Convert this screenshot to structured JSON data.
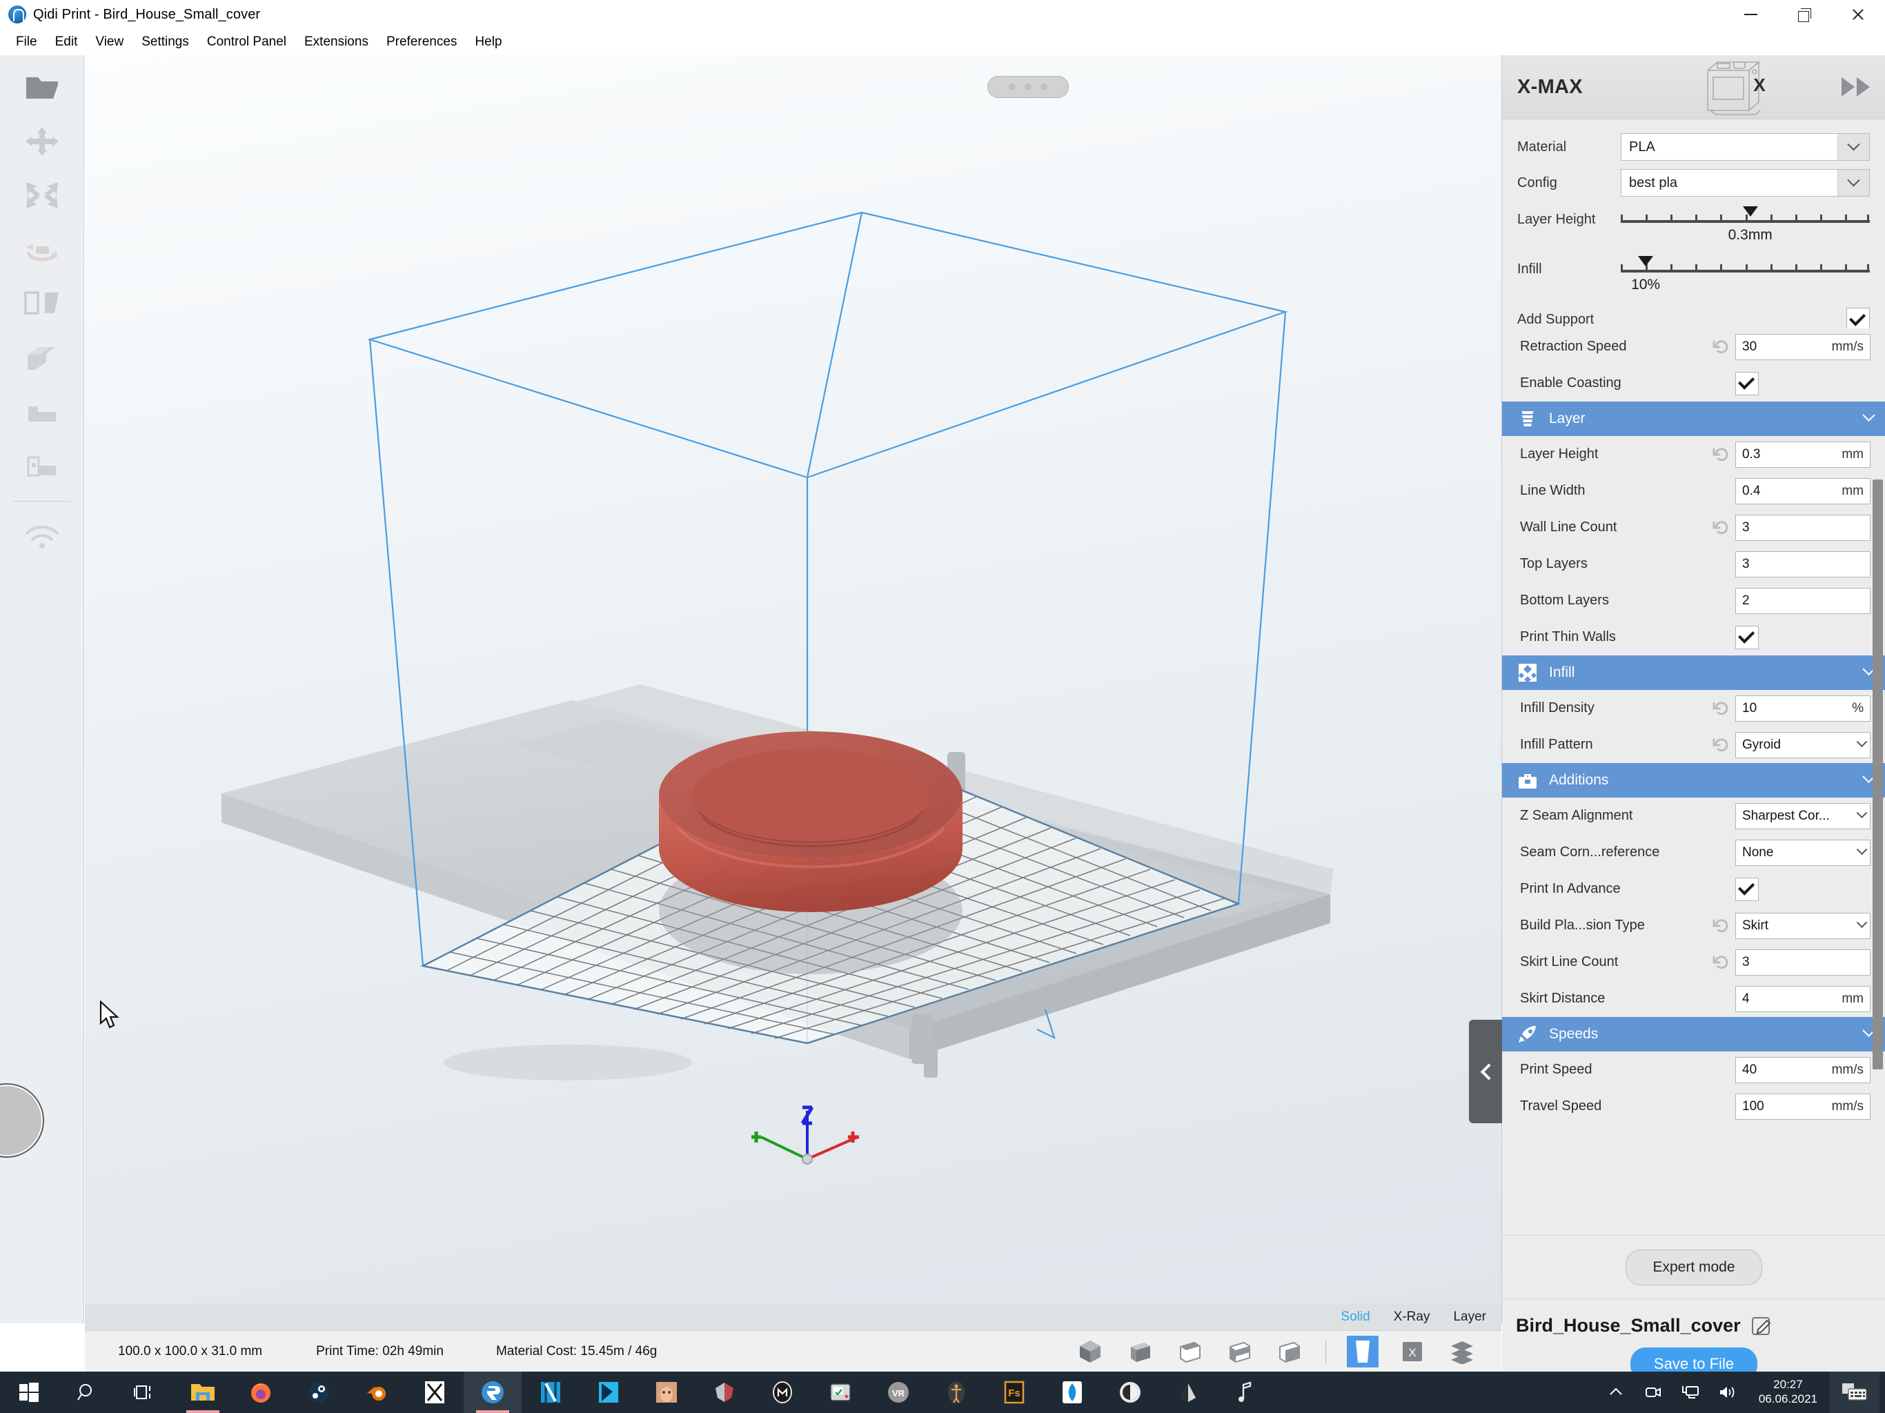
{
  "window": {
    "title": "Qidi Print - Bird_House_Small_cover",
    "app_icon": "qidi-logo-icon",
    "controls": {
      "minimize": "minimize-icon",
      "restore": "restore-icon",
      "close": "close-icon"
    }
  },
  "menubar": {
    "items": [
      "File",
      "Edit",
      "View",
      "Settings",
      "Control Panel",
      "Extensions",
      "Preferences",
      "Help"
    ]
  },
  "left_toolbar": {
    "items": [
      {
        "name": "open-file-icon",
        "tip": "Open File"
      },
      {
        "name": "move-icon",
        "tip": "Move"
      },
      {
        "name": "scale-icon",
        "tip": "Scale"
      },
      {
        "name": "rotate-icon",
        "tip": "Rotate"
      },
      {
        "name": "mirror-icon",
        "tip": "Mirror"
      },
      {
        "name": "support-blocker-icon",
        "tip": "Support Blocker"
      },
      {
        "name": "per-model-settings-icon",
        "tip": "Per Model Settings"
      },
      {
        "name": "multiply-model-icon",
        "tip": "Multiply Model"
      },
      {
        "name": "wifi-icon",
        "tip": "Wi-Fi Connection"
      }
    ]
  },
  "viewport": {
    "model_color": "#c2584c",
    "buildplate_outline_color": "#4a9de0",
    "axis_colors": {
      "x": "#d52b2b",
      "y": "#1aa01a",
      "z": "#2222dd"
    },
    "top_pill": "drag-handle"
  },
  "viewmodes": {
    "items": [
      {
        "label": "Solid",
        "active": true
      },
      {
        "label": "X-Ray",
        "active": false
      },
      {
        "label": "Layer",
        "active": false
      }
    ],
    "active_color": "#3ba0e8"
  },
  "statusbar": {
    "dimensions": "100.0 x 100.0 x 31.0 mm",
    "print_time": "Print Time: 02h 49min",
    "material_cost": "Material Cost: 15.45m / 46g",
    "view_icons": [
      "view-3d-icon",
      "view-front-icon",
      "view-top-icon",
      "view-left-icon",
      "view-right-icon"
    ],
    "mode_icons": [
      {
        "name": "solid-view-icon",
        "selected": true
      },
      {
        "name": "xray-view-icon",
        "selected": false
      },
      {
        "name": "layer-view-icon",
        "selected": false
      }
    ]
  },
  "right_panel": {
    "printer_name": "X-MAX",
    "printer_thumb": "printer-xmax-icon",
    "collapse_forward": "fast-forward-icon",
    "quick": {
      "material": {
        "label": "Material",
        "value": "PLA"
      },
      "config": {
        "label": "Config",
        "value": "best pla"
      },
      "layer_height": {
        "label": "Layer Height",
        "value": "0.3mm",
        "knob_pct": 52,
        "ticks": 11
      },
      "infill": {
        "label": "Infill",
        "value": "10%",
        "knob_pct": 10,
        "ticks": 11
      },
      "add_support": {
        "label": "Add Support",
        "checked": true
      }
    },
    "settings": [
      {
        "kind": "row",
        "label": "Retraction Speed",
        "revert": true,
        "type": "text",
        "value": "30",
        "unit": "mm/s"
      },
      {
        "kind": "row",
        "label": "Enable Coasting",
        "revert": false,
        "type": "check",
        "checked": true
      },
      {
        "kind": "section",
        "label": "Layer",
        "icon": "layer-stack-icon"
      },
      {
        "kind": "row",
        "label": "Layer Height",
        "revert": true,
        "type": "text",
        "value": "0.3",
        "unit": "mm"
      },
      {
        "kind": "row",
        "label": "Line Width",
        "revert": false,
        "type": "text",
        "value": "0.4",
        "unit": "mm"
      },
      {
        "kind": "row",
        "label": "Wall Line Count",
        "revert": true,
        "type": "text",
        "value": "3",
        "unit": ""
      },
      {
        "kind": "row",
        "label": "Top Layers",
        "revert": false,
        "type": "text",
        "value": "3",
        "unit": ""
      },
      {
        "kind": "row",
        "label": "Bottom Layers",
        "revert": false,
        "type": "text",
        "value": "2",
        "unit": ""
      },
      {
        "kind": "row",
        "label": "Print Thin Walls",
        "revert": false,
        "type": "check",
        "checked": true
      },
      {
        "kind": "section",
        "label": "Infill",
        "icon": "infill-pattern-icon"
      },
      {
        "kind": "row",
        "label": "Infill Density",
        "revert": true,
        "type": "text",
        "value": "10",
        "unit": "%"
      },
      {
        "kind": "row",
        "label": "Infill Pattern",
        "revert": true,
        "type": "select",
        "value": "Gyroid"
      },
      {
        "kind": "section",
        "label": "Additions",
        "icon": "toolbox-icon"
      },
      {
        "kind": "row",
        "label": "Z Seam Alignment",
        "revert": false,
        "type": "select",
        "value": "Sharpest Cor..."
      },
      {
        "kind": "row",
        "label": "Seam Corn...reference",
        "revert": false,
        "type": "select",
        "value": "None"
      },
      {
        "kind": "row",
        "label": "Print In Advance",
        "revert": false,
        "type": "check",
        "checked": true
      },
      {
        "kind": "row",
        "label": "Build Pla...sion Type",
        "revert": true,
        "type": "select",
        "value": "Skirt"
      },
      {
        "kind": "row",
        "label": "Skirt Line Count",
        "revert": true,
        "type": "text",
        "value": "3",
        "unit": ""
      },
      {
        "kind": "row",
        "label": "Skirt Distance",
        "revert": false,
        "type": "text",
        "value": "4",
        "unit": "mm"
      },
      {
        "kind": "section",
        "label": "Speeds",
        "icon": "rocket-icon"
      },
      {
        "kind": "row",
        "label": "Print Speed",
        "revert": false,
        "type": "text",
        "value": "40",
        "unit": "mm/s"
      },
      {
        "kind": "row",
        "label": "Travel Speed",
        "revert": false,
        "type": "text",
        "value": "100",
        "unit": "mm/s"
      }
    ],
    "expert_button": "Expert mode",
    "object_name": "Bird_House_Small_cover",
    "edit_icon": "edit-pencil-icon",
    "save_button": "Save to File",
    "accent_color": "#41a0f0",
    "section_color": "#6195d4"
  },
  "taskbar": {
    "start": "windows-start-icon",
    "search": "search-icon",
    "taskview": "task-view-icon",
    "apps": [
      {
        "name": "file-explorer-icon",
        "active": false,
        "underline": true
      },
      {
        "name": "firefox-icon",
        "active": false,
        "underline": false
      },
      {
        "name": "steam-icon",
        "active": false,
        "underline": false
      },
      {
        "name": "blender-icon",
        "active": false,
        "underline": false
      },
      {
        "name": "xlaunch-icon",
        "active": false,
        "underline": false
      },
      {
        "name": "qidi-print-icon",
        "active": true,
        "underline": true
      },
      {
        "name": "video-editor-icon",
        "active": false,
        "underline": false
      },
      {
        "name": "media-app-icon",
        "active": false,
        "underline": false
      },
      {
        "name": "photo-app-icon",
        "active": false,
        "underline": false
      },
      {
        "name": "gem-icon",
        "active": false,
        "underline": false
      },
      {
        "name": "meshmixer-icon",
        "active": false,
        "underline": false
      },
      {
        "name": "retro-app-icon",
        "active": false,
        "underline": false
      },
      {
        "name": "vr-icon",
        "active": false,
        "underline": false
      },
      {
        "name": "anatomy-icon",
        "active": false,
        "underline": false
      },
      {
        "name": "fusion-icon",
        "active": false,
        "underline": false
      },
      {
        "name": "diamond-icon",
        "active": false,
        "underline": false
      },
      {
        "name": "disc-icon",
        "active": false,
        "underline": false
      },
      {
        "name": "inkscape-icon",
        "active": false,
        "underline": false
      },
      {
        "name": "music-icon",
        "active": false,
        "underline": false
      }
    ],
    "tray": [
      {
        "name": "show-hidden-icons-chevron"
      },
      {
        "name": "camera-icon"
      },
      {
        "name": "network-icon"
      },
      {
        "name": "volume-icon"
      }
    ],
    "clock_time": "20:27",
    "clock_date": "06.06.2021",
    "ime": "keyboard-ime-icon"
  }
}
